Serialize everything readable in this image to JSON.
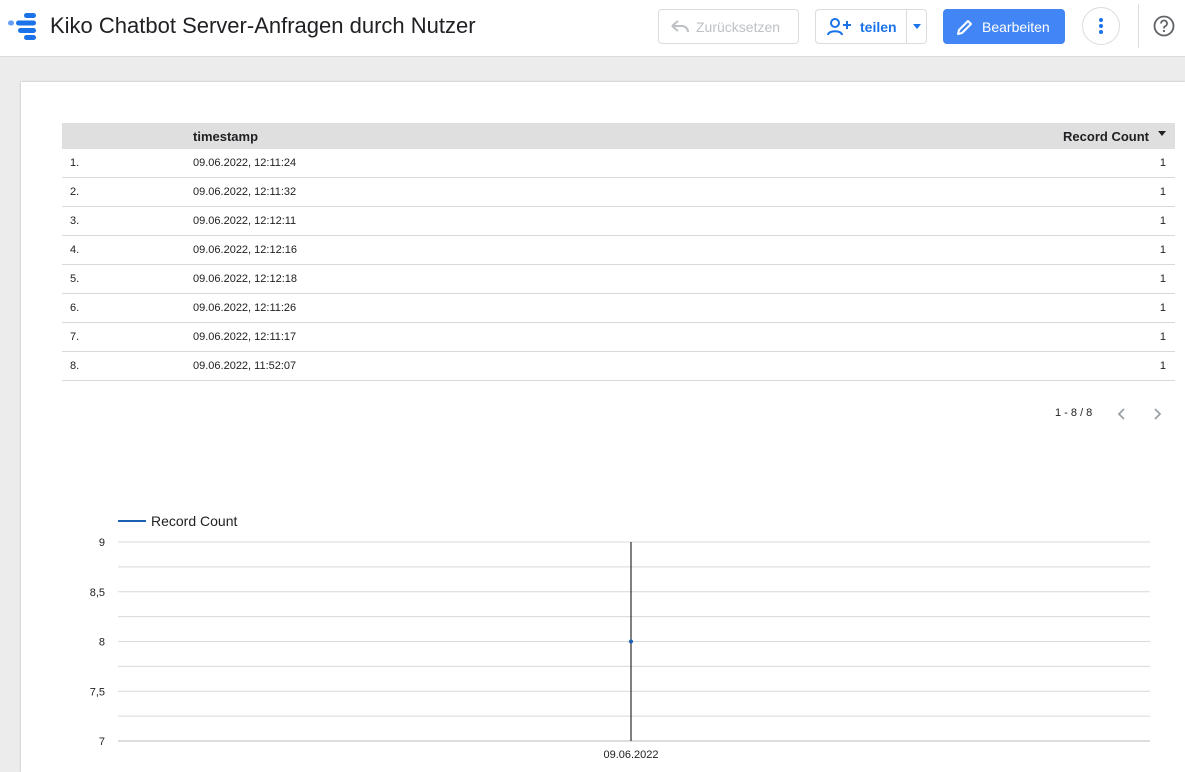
{
  "header": {
    "title": "Kiko Chatbot Server-Anfragen durch Nutzer",
    "reset_label": "Zurücksetzen",
    "share_label": "teilen",
    "edit_label": "Bearbeiten",
    "accent_color": "#4285f4"
  },
  "table": {
    "columns": [
      "timestamp",
      "Record Count"
    ],
    "rows": [
      {
        "index": "1.",
        "timestamp": "09.06.2022, 12:11:24",
        "count": "1"
      },
      {
        "index": "2.",
        "timestamp": "09.06.2022, 12:11:32",
        "count": "1"
      },
      {
        "index": "3.",
        "timestamp": "09.06.2022, 12:12:11",
        "count": "1"
      },
      {
        "index": "4.",
        "timestamp": "09.06.2022, 12:12:16",
        "count": "1"
      },
      {
        "index": "5.",
        "timestamp": "09.06.2022, 12:12:18",
        "count": "1"
      },
      {
        "index": "6.",
        "timestamp": "09.06.2022, 12:11:26",
        "count": "1"
      },
      {
        "index": "7.",
        "timestamp": "09.06.2022, 12:11:17",
        "count": "1"
      },
      {
        "index": "8.",
        "timestamp": "09.06.2022, 11:52:07",
        "count": "1"
      }
    ],
    "pagination": "1 - 8 / 8"
  },
  "chart_data": {
    "type": "line",
    "x": [
      "09.06.2022"
    ],
    "series": [
      {
        "name": "Record Count",
        "values": [
          8
        ]
      }
    ],
    "ylim": [
      7,
      9
    ],
    "yticks": [
      "9",
      "8,5",
      "8",
      "7,5",
      "7"
    ],
    "grid": true,
    "legend": "top-left",
    "line_color": "#1a5fb4"
  }
}
